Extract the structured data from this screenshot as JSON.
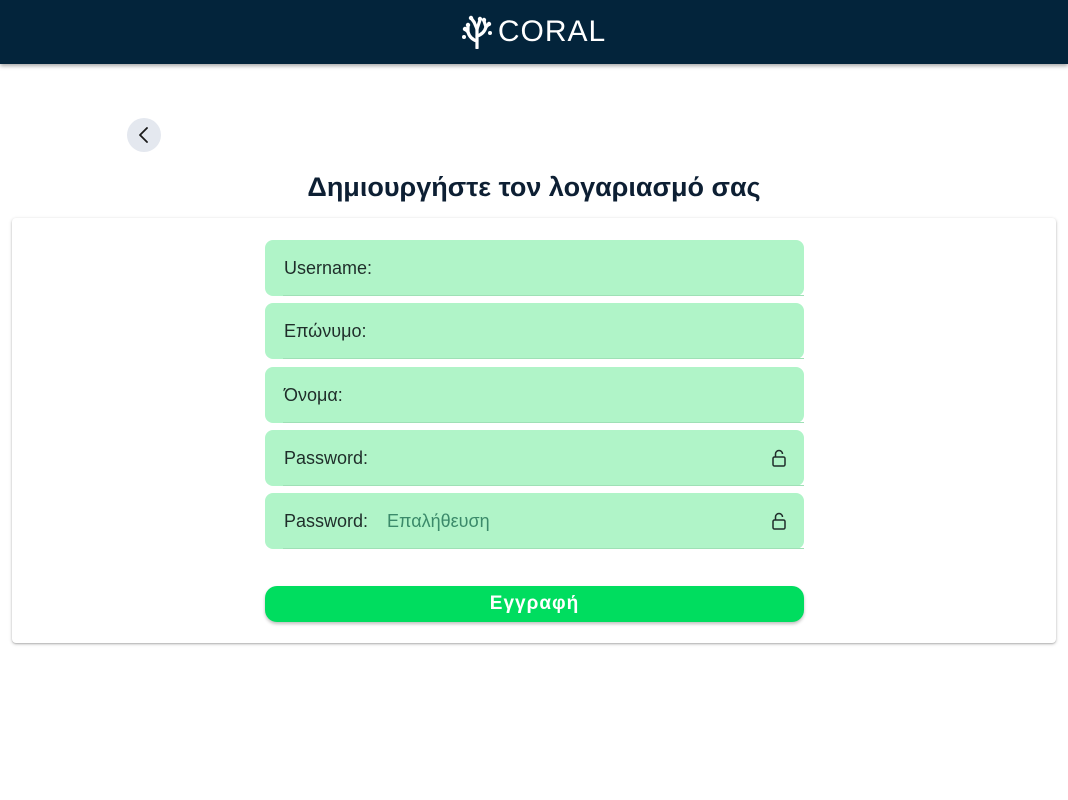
{
  "header": {
    "brand_name": "CORAL",
    "logo_icon": "coral-icon",
    "background_color": "#03243b"
  },
  "navigation": {
    "back_icon": "chevron-left-icon"
  },
  "page": {
    "title": "Δημιουργήστε τον λογαριασμό σας"
  },
  "form": {
    "fields": [
      {
        "label": "Username:",
        "value": "",
        "placeholder": ""
      },
      {
        "label": "Επώνυμο:",
        "value": "",
        "placeholder": ""
      },
      {
        "label": "Όνομα:",
        "value": "",
        "placeholder": ""
      },
      {
        "label": "Password:",
        "value": "",
        "placeholder": "",
        "icon": "lock-icon"
      },
      {
        "label": "Password:",
        "value": "",
        "placeholder": "Επαλήθευση",
        "icon": "lock-icon"
      }
    ],
    "field_color": "#b0f4c8",
    "submit_label": "Εγγραφή",
    "submit_color": "#00dd5f"
  }
}
